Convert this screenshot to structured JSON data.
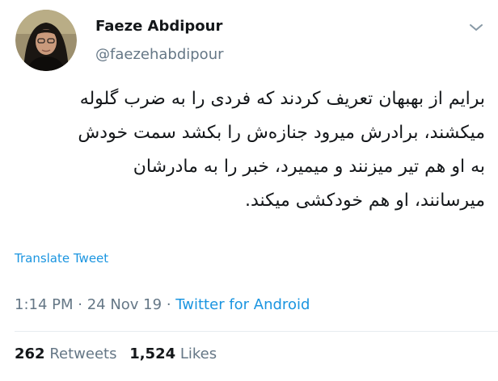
{
  "author": {
    "display_name": "Faeze Abdipour",
    "handle": "@faezehabdipour"
  },
  "tweet": {
    "lines": [
      "برایم از بهبهان تعریف کردند که فردی را به ضرب گلوله",
      "میکشند، برادرش میرود جنازه‌ش را بکشد سمت خودش",
      "به او هم تیر میزنند و میمیرد، خبر را به مادرشان",
      "میرسانند، او هم خودکشی میکند."
    ],
    "translate_label": "Translate Tweet"
  },
  "meta": {
    "time": "1:14 PM",
    "separator1": " · ",
    "date": "24 Nov 19",
    "separator2": " · ",
    "source": "Twitter for Android"
  },
  "stats": {
    "retweets_count": "262",
    "retweets_label": "Retweets",
    "likes_count": "1,524",
    "likes_label": "Likes"
  },
  "icons": {
    "caret": "chevron-down-icon"
  },
  "colors": {
    "link": "#1b95e0",
    "secondary": "#657786",
    "primary_text": "#14171a"
  }
}
